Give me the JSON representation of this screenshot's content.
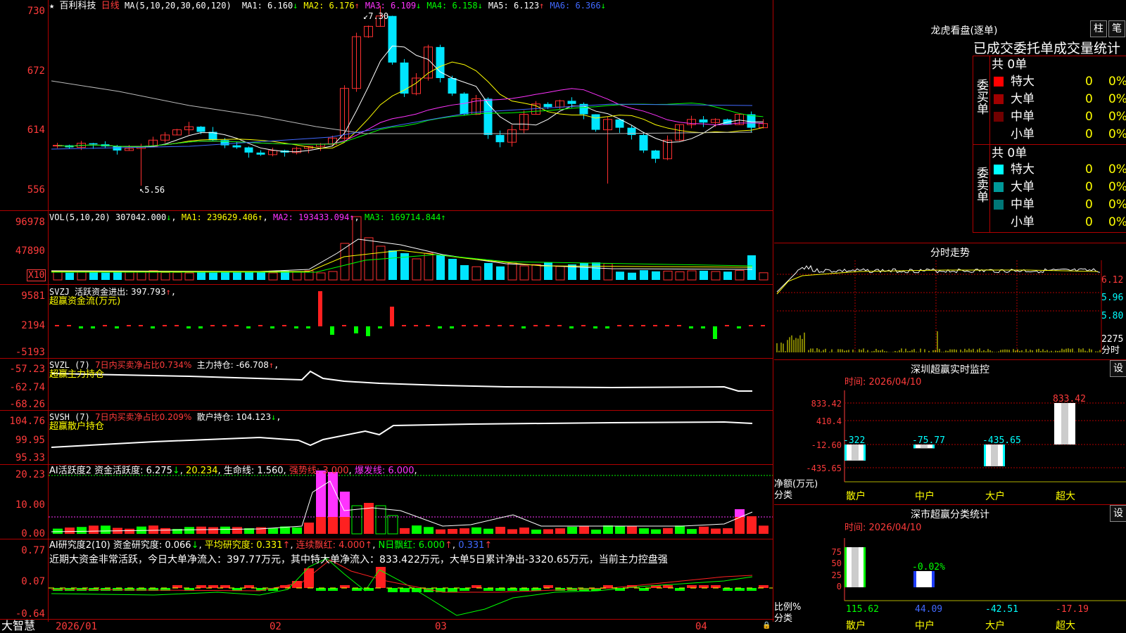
{
  "stock": {
    "star": "★",
    "name": "百利科技",
    "period": "日线",
    "ma_label": "MA(5,10,20,30,60,120)"
  },
  "price_ma": [
    {
      "text": "MA1: 6.160",
      "arrow": "↓",
      "color": "#ffffff"
    },
    {
      "text": "MA2: 6.176",
      "arrow": "↑",
      "color": "#ffff00"
    },
    {
      "text": "MA3: 6.109",
      "arrow": "↓",
      "color": "#ff33ff"
    },
    {
      "text": "MA4: 6.158",
      "arrow": "↓",
      "color": "#00ff00"
    },
    {
      "text": "MA5: 6.123",
      "arrow": "↑",
      "color": "#ffffff"
    },
    {
      "text": "MA6: 6.366",
      "arrow": "↓",
      "color": "#4169ff"
    }
  ],
  "price_axis": [
    "730",
    "672",
    "614",
    "556"
  ],
  "price_annotations": {
    "high": "7.30",
    "low": "5.56"
  },
  "vol": {
    "label": "VOL(5,10,20)",
    "value": "307042.000",
    "ma1": "MA1: 239629.406",
    "ma2": "MA2: 193433.094",
    "ma3": "MA3: 169714.844",
    "axis": [
      "96978",
      "47890"
    ],
    "unit": "X10"
  },
  "svzj": {
    "label": "SVZJ",
    "title": "活跃资金进出: 397.793",
    "sub": "超赢资金流(万元)",
    "axis": [
      "9581",
      "2194",
      "-5193"
    ]
  },
  "svzl": {
    "label": "SVZL (7)",
    "desc": "7日内买卖净占比0.734%",
    "value": "主力持仓: -66.708",
    "sub": "超赢主力持仓",
    "axis": [
      "-57.23",
      "-62.74",
      "-68.26"
    ]
  },
  "svsh": {
    "label": "SVSH (7)",
    "desc": "7日内买卖净占比0.209%",
    "value": "散户持仓: 104.123",
    "sub": "超赢散户持仓",
    "axis": [
      "104.76",
      "99.95",
      "95.33"
    ]
  },
  "ai1": {
    "label": "AI活跃度2",
    "v1": "资金活跃度: 6.275",
    "v2": "20.234",
    "v3": "生命线: 1.560",
    "v4": "强势线: 3.000",
    "v5": "爆发线: 6.000",
    "axis": [
      "20.23",
      "10.00",
      "0.00"
    ]
  },
  "ai2": {
    "label": "AI研究度2(10)",
    "v1": "资金研究度: 0.066",
    "v2": "平均研究度: 0.331",
    "v3": "连续飘红: 4.000",
    "v4": "N日飘红: 6.000",
    "v5": "0.331",
    "summary": "近期大资金非常活跃，今日大单净流入：397.77万元，其中特大单净流入：833.422万元，大单5日累计净出-3320.65万元，当前主力控盘强",
    "axis": [
      "0.77",
      "0.07",
      "-0.64"
    ]
  },
  "dates": [
    "2026/01",
    "02",
    "03",
    "04"
  ],
  "brand": "大智慧",
  "right": {
    "longhu_title": "龙虎看盘(逐单)",
    "btn1": "柱",
    "btn2": "笔",
    "stats_title": "已成交委托单成交量统计",
    "buy_side": "委买单",
    "sell_side": "委卖单",
    "buy_total": "共 0单",
    "sell_total": "共 0单",
    "buy_rows": [
      {
        "name": "特大",
        "n": "0",
        "p": "0%",
        "color": "#ff0000"
      },
      {
        "name": "大单",
        "n": "0",
        "p": "0%",
        "color": "#a00000"
      },
      {
        "name": "中单",
        "n": "0",
        "p": "0%",
        "color": "#700000"
      },
      {
        "name": "小单",
        "n": "0",
        "p": "0%",
        "color": ""
      }
    ],
    "sell_rows": [
      {
        "name": "特大",
        "n": "0",
        "p": "0%",
        "color": "#00ffff"
      },
      {
        "name": "大单",
        "n": "0",
        "p": "0%",
        "color": "#009999"
      },
      {
        "name": "中单",
        "n": "0",
        "p": "0%",
        "color": "#007777"
      },
      {
        "name": "小单",
        "n": "0",
        "p": "0%",
        "color": ""
      }
    ],
    "fenshi_title": "分时走势",
    "fenshi_axis": [
      "6.12",
      "5.96",
      "5.80",
      "2275",
      "分时"
    ],
    "monitor_title": "深圳超赢实时监控",
    "monitor_btn": "设",
    "monitor_time": "时间: 2026/04/10",
    "monitor_axis": [
      "833.42",
      "410.4",
      "-12.60",
      "-435.65"
    ],
    "monitor_ylabel": "净额(万元)",
    "monitor_xlabel": "分类",
    "monitor_values": [
      "-322",
      "-75.77",
      "-435.65",
      "833.42"
    ],
    "monitor_cats": [
      "散户",
      "中户",
      "大户",
      "超大"
    ],
    "class_title": "深市超赢分类统计",
    "class_btn": "设",
    "class_time": "时间: 2026/04/10",
    "class_axis": [
      "75",
      "50",
      "25",
      "0"
    ],
    "class_ylabel": "比例%",
    "class_xlabel": "分类",
    "class_values": [
      "115.62",
      "44.09",
      "-42.51",
      "-17.19"
    ],
    "class_mid_label": "-0.02%",
    "class_cats": [
      "散户",
      "中户",
      "大户",
      "超大"
    ]
  }
}
